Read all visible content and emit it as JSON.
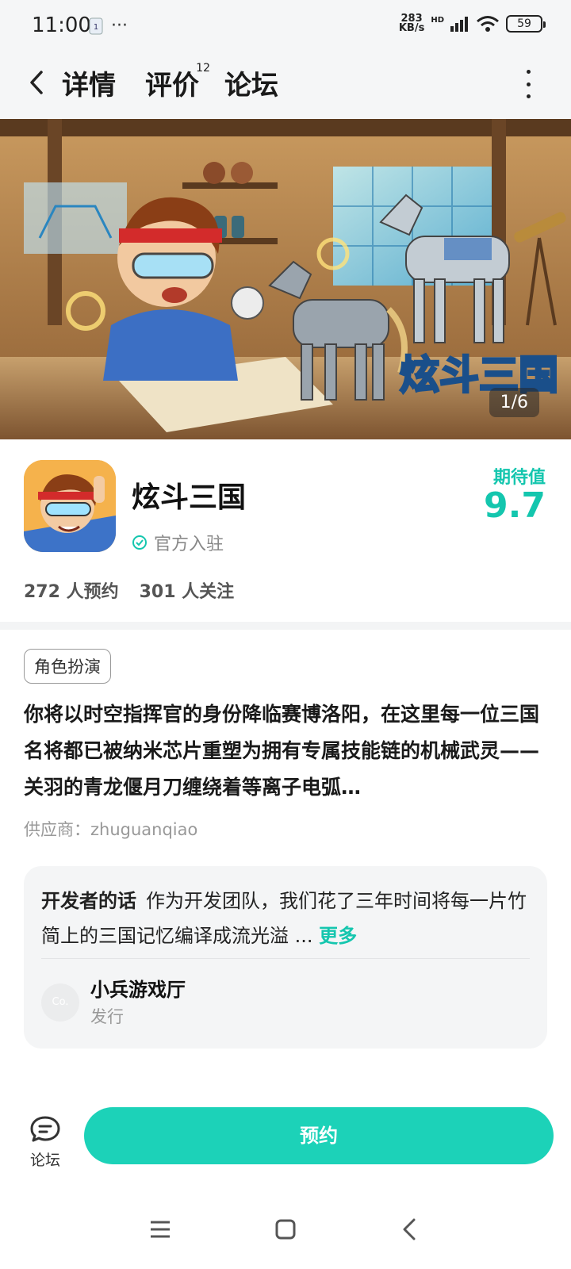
{
  "status_bar": {
    "time": "11:00",
    "dots": "···",
    "net_speed_value": "283",
    "net_speed_unit": "KB/s",
    "hd": "HD",
    "battery": "59"
  },
  "nav": {
    "tabs": [
      {
        "label": "详情",
        "active": true
      },
      {
        "label": "评价",
        "badge": "12"
      },
      {
        "label": "论坛"
      }
    ]
  },
  "banner": {
    "counter": "1/6",
    "logo_text": "炫斗三国"
  },
  "app": {
    "name": "炫斗三国",
    "official_label": "官方入驻",
    "expect_label": "期待值",
    "expect_score": "9.7",
    "reservations": "272 人预约",
    "followers": "301 人关注"
  },
  "details": {
    "tag": "角色扮演",
    "description": "你将以时空指挥官的身份降临赛博洛阳，在这里每一位三国名将都已被纳米芯片重塑为拥有专属技能链的机械武灵——关羽的青龙偃月刀缠绕着等离子电弧…",
    "supplier": "供应商：zhuguanqiao"
  },
  "developer": {
    "title": "开发者的话",
    "text": "作为开发团队，我们花了三年时间将每一片竹简上的三国记忆编译成流光溢 ...",
    "more": "更多",
    "publisher_name": "小兵游戏厅",
    "publisher_role": "发行",
    "avatar_text": "Co."
  },
  "bottom": {
    "forum_label": "论坛",
    "reserve_label": "预约"
  },
  "colors": {
    "accent": "#1cd2b8",
    "score": "#14c6ae"
  }
}
